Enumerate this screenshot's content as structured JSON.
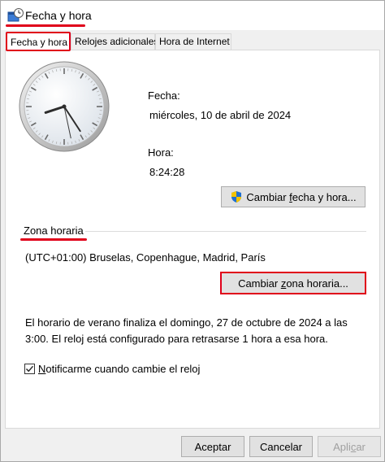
{
  "window": {
    "title": "Fecha y hora"
  },
  "tabs": [
    {
      "label": "Fecha y hora",
      "active": true
    },
    {
      "label": "Relojes adicionales",
      "active": false
    },
    {
      "label": "Hora de Internet",
      "active": false
    }
  ],
  "clock": {
    "hour": 8,
    "minute": 24,
    "second": 28
  },
  "date_section": {
    "date_label": "Fecha:",
    "date_value": "miércoles, 10 de abril de 2024",
    "time_label": "Hora:",
    "time_value": "8:24:28",
    "change_button_pre": "Cambiar ",
    "change_button_u": "f",
    "change_button_post": "echa y hora..."
  },
  "timezone": {
    "group_label": "Zona horaria",
    "value": "(UTC+01:00) Bruselas, Copenhague, Madrid, París",
    "change_button_pre": "Cambiar ",
    "change_button_u": "z",
    "change_button_post": "ona horaria..."
  },
  "dst_info": "El horario de verano finaliza el domingo, 27 de octubre de 2024 a las 3:00. El reloj está configurado para retrasarse 1 hora a esa hora.",
  "notify": {
    "checked": true,
    "label_u": "N",
    "label_rest": "otificarme cuando cambie el reloj"
  },
  "footer": {
    "ok": "Aceptar",
    "cancel": "Cancelar",
    "apply_pre": "Apli",
    "apply_u": "c",
    "apply_post": "ar"
  },
  "colors": {
    "highlight": "#e0001a",
    "shield_blue": "#1f6fd1",
    "shield_yellow": "#f2c200"
  }
}
